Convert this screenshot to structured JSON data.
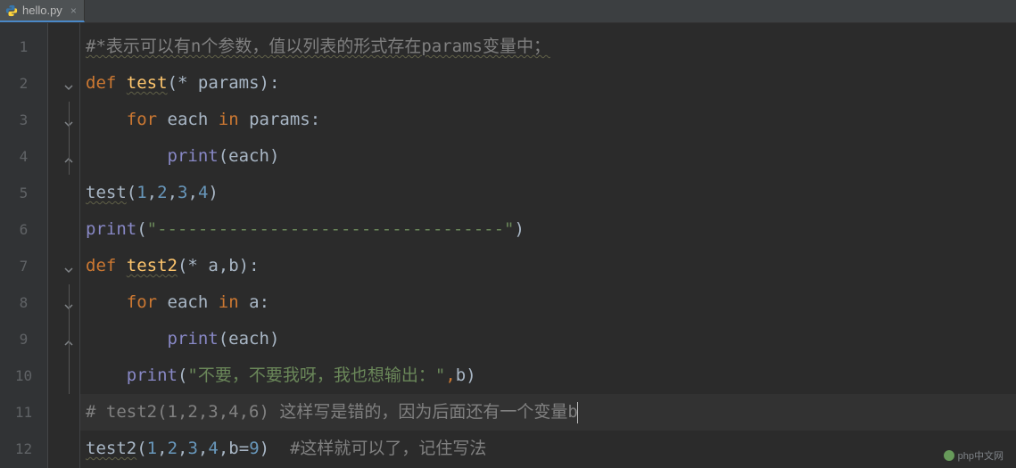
{
  "tab": {
    "filename": "hello.py",
    "close_glyph": "×"
  },
  "gutter": {
    "lines": [
      "1",
      "2",
      "3",
      "4",
      "5",
      "6",
      "7",
      "8",
      "9",
      "10",
      "11",
      "12"
    ]
  },
  "code": {
    "l1": {
      "comment": "#*表示可以有n个参数，值以列表的形式存在params变量中；"
    },
    "l2": {
      "kw_def": "def",
      "name": "test",
      "sig_open": "(* ",
      "param": "params",
      "sig_close": "):"
    },
    "l3": {
      "kw_for": "for",
      "var": "each",
      "kw_in": "in",
      "iter": "params",
      "colon": ":"
    },
    "l4": {
      "fn": "print",
      "open": "(",
      "arg": "each",
      "close": ")"
    },
    "l5": {
      "call": "test",
      "open": "(",
      "n1": "1",
      "c1": ",",
      "n2": "2",
      "c2": ",",
      "n3": "3",
      "c3": ",",
      "n4": "4",
      "close": ")"
    },
    "l6": {
      "fn": "print",
      "open": "(",
      "str": "\"----------------------------------\"",
      "close": ")"
    },
    "l7": {
      "kw_def": "def",
      "name": "test2",
      "sig_open": "(* ",
      "p1": "a",
      "comma": ",",
      "p2": "b",
      "sig_close": "):"
    },
    "l8": {
      "kw_for": "for",
      "var": "each",
      "kw_in": "in",
      "iter": "a",
      "colon": ":"
    },
    "l9": {
      "fn": "print",
      "open": "(",
      "arg": "each",
      "close": ")"
    },
    "l10": {
      "fn": "print",
      "open": "(",
      "str": "\"不要，不要我呀，我也想输出：\"",
      "comma": ",",
      "arg": "b",
      "close": ")"
    },
    "l11": {
      "comment": "# test2(1,2,3,4,6) 这样写是错的，因为后面还有一个变量b"
    },
    "l12": {
      "call": "test2",
      "open": "(",
      "n1": "1",
      "c1": ",",
      "n2": "2",
      "c2": ",",
      "n3": "3",
      "c3": ",",
      "n4": "4",
      "c4": ",",
      "kw": "b",
      "eq": "=",
      "n5": "9",
      "close": ")",
      "sp": "  ",
      "comment": "#这样就可以了，记住写法"
    }
  },
  "watermark": {
    "text": "php中文网"
  }
}
